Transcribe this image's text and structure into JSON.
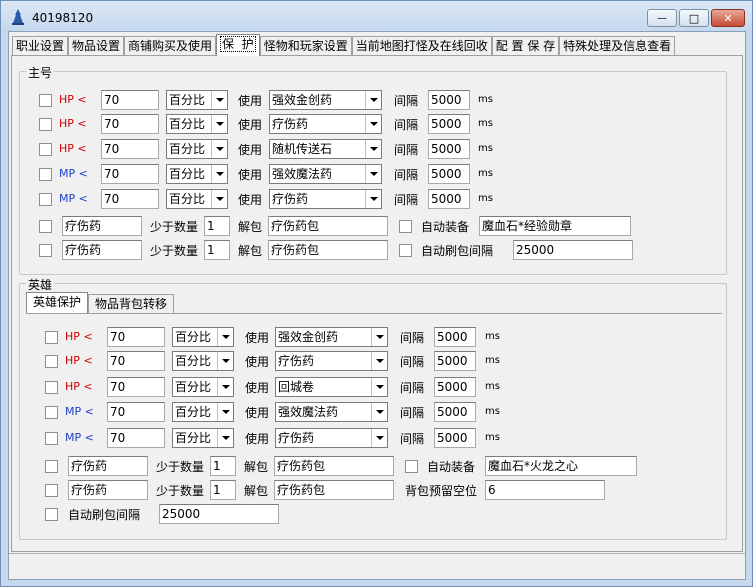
{
  "window": {
    "title": "40198120",
    "minimize_label": "—",
    "maximize_label": "□",
    "close_label": "✕"
  },
  "tabs": [
    "职业设置",
    "物品设置",
    "商铺购买及使用",
    "保  护",
    "怪物和玩家设置",
    "当前地图打怪及在线回收",
    "配 置 保 存",
    "特殊处理及信息查看"
  ],
  "main": {
    "label": "主号",
    "rows": [
      {
        "stat": "HP <",
        "threshold": "70",
        "mode": "百分比",
        "use_label": "使用",
        "item": "强效金创药",
        "interval_label": "间隔",
        "interval": "5000",
        "unit": "ms"
      },
      {
        "stat": "HP <",
        "threshold": "70",
        "mode": "百分比",
        "use_label": "使用",
        "item": "疗伤药",
        "interval_label": "间隔",
        "interval": "5000",
        "unit": "ms"
      },
      {
        "stat": "HP <",
        "threshold": "70",
        "mode": "百分比",
        "use_label": "使用",
        "item": "随机传送石",
        "interval_label": "间隔",
        "interval": "5000",
        "unit": "ms"
      },
      {
        "stat": "MP <",
        "threshold": "70",
        "mode": "百分比",
        "use_label": "使用",
        "item": "强效魔法药",
        "interval_label": "间隔",
        "interval": "5000",
        "unit": "ms"
      },
      {
        "stat": "MP <",
        "threshold": "70",
        "mode": "百分比",
        "use_label": "使用",
        "item": "疗伤药",
        "interval_label": "间隔",
        "interval": "5000",
        "unit": "ms"
      }
    ],
    "unpack": [
      {
        "item": "疗伤药",
        "min_label": "少于数量",
        "min": "1",
        "unpack_label": "解包",
        "pack": "疗伤药包",
        "opt_label": "自动装备",
        "opt_value": "魔血石*经验勋章"
      },
      {
        "item": "疗伤药",
        "min_label": "少于数量",
        "min": "1",
        "unpack_label": "解包",
        "pack": "疗伤药包",
        "opt_label": "自动刷包间隔",
        "opt_value": "25000"
      }
    ]
  },
  "hero": {
    "label": "英雄",
    "subtabs": [
      "英雄保护",
      "物品背包转移"
    ],
    "rows": [
      {
        "stat": "HP <",
        "threshold": "70",
        "mode": "百分比",
        "use_label": "使用",
        "item": "强效金创药",
        "interval_label": "间隔",
        "interval": "5000",
        "unit": "ms"
      },
      {
        "stat": "HP <",
        "threshold": "70",
        "mode": "百分比",
        "use_label": "使用",
        "item": "疗伤药",
        "interval_label": "间隔",
        "interval": "5000",
        "unit": "ms"
      },
      {
        "stat": "HP <",
        "threshold": "70",
        "mode": "百分比",
        "use_label": "使用",
        "item": "回城卷",
        "interval_label": "间隔",
        "interval": "5000",
        "unit": "ms"
      },
      {
        "stat": "MP <",
        "threshold": "70",
        "mode": "百分比",
        "use_label": "使用",
        "item": "强效魔法药",
        "interval_label": "间隔",
        "interval": "5000",
        "unit": "ms"
      },
      {
        "stat": "MP <",
        "threshold": "70",
        "mode": "百分比",
        "use_label": "使用",
        "item": "疗伤药",
        "interval_label": "间隔",
        "interval": "5000",
        "unit": "ms"
      }
    ],
    "unpack": [
      {
        "item": "疗伤药",
        "min_label": "少于数量",
        "min": "1",
        "unpack_label": "解包",
        "pack": "疗伤药包",
        "opt_label": "自动装备",
        "opt_value": "魔血石*火龙之心"
      },
      {
        "item": "疗伤药",
        "min_label": "少于数量",
        "min": "1",
        "unpack_label": "解包",
        "pack": "疗伤药包",
        "opt_label": "背包预留空位",
        "opt_value": "6"
      }
    ],
    "refresh_label": "自动刷包间隔",
    "refresh_value": "25000"
  }
}
